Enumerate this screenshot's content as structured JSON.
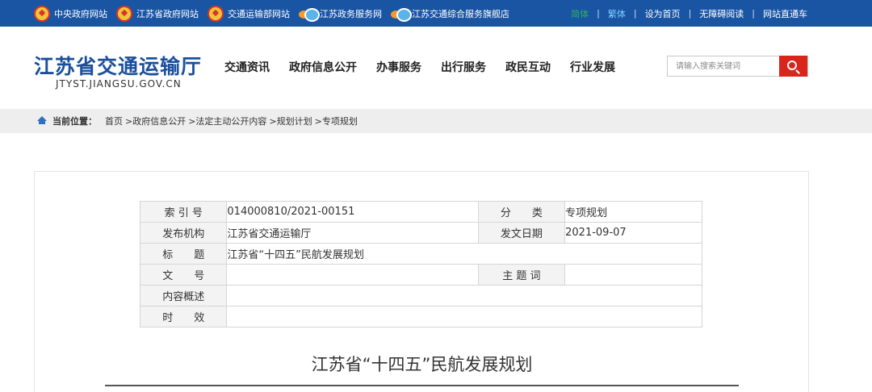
{
  "topbar": {
    "links": [
      {
        "label": "中央政府网站",
        "icon": "national-emblem-icon"
      },
      {
        "label": "江苏省政府网站",
        "icon": "national-emblem-icon"
      },
      {
        "label": "交通运输部网站",
        "icon": "national-emblem-icon"
      },
      {
        "label": "江苏政务服务网",
        "icon": "cloud-logo-icon"
      },
      {
        "label": "江苏交通综合服务旗舰店",
        "icon": "cloud-logo-icon"
      }
    ],
    "right": {
      "simplified": "简体",
      "traditional": "繁体",
      "set_home": "设为首页",
      "accessible": "无障碍阅读",
      "express": "网站直通车",
      "separator": "|"
    },
    "colors": {
      "background": "#1a55a4",
      "simplified": "#2fb15a",
      "traditional": "#7fd0ff"
    }
  },
  "header": {
    "logo_cn": "江苏省交通运输厅",
    "logo_en": "JTYST.JIANGSU.GOV.CN",
    "nav": [
      "交通资讯",
      "政府信息公开",
      "办事服务",
      "出行服务",
      "政民互动",
      "行业发展"
    ],
    "search": {
      "placeholder": "请输入搜索关键词",
      "button_icon": "search-icon",
      "button_color": "#d9251c"
    }
  },
  "breadcrumb": {
    "label": "当前位置：",
    "items": [
      "首页",
      ">政府信息公开",
      ">法定主动公开内容",
      ">规划计划",
      ">专项规划"
    ]
  },
  "meta": {
    "rows": [
      {
        "l1": "索 引 号",
        "v1": "014000810/2021-00151",
        "l2": "分　　类",
        "v2": "专项规划"
      },
      {
        "l1": "发布机构",
        "v1": "江苏省交通运输厅",
        "l2": "发文日期",
        "v2": "2021-09-07"
      },
      {
        "l1": "标　　题",
        "v1": "江苏省“十四五”民航发展规划"
      },
      {
        "l1": "文　　号",
        "v1": "",
        "l2": "主 题 词",
        "v2": ""
      },
      {
        "l1": "内容概述",
        "v1": ""
      },
      {
        "l1": "时　　效",
        "v1": ""
      }
    ]
  },
  "document": {
    "title": "江苏省“十四五”民航发展规划"
  }
}
